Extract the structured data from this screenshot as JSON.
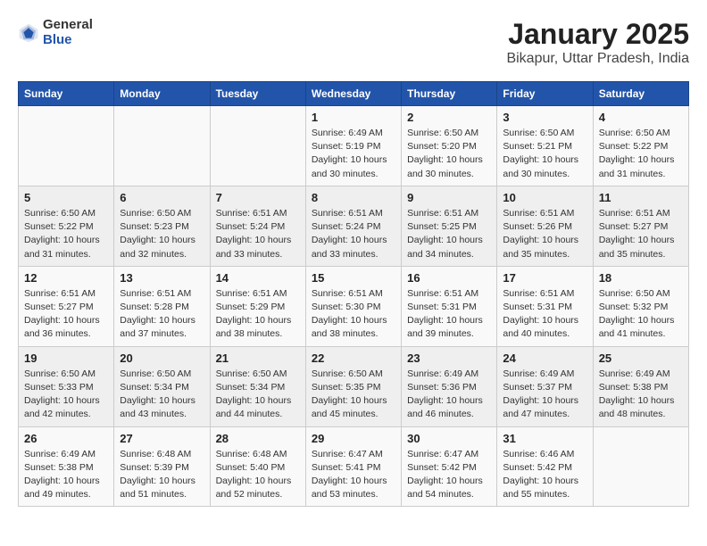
{
  "header": {
    "logo_general": "General",
    "logo_blue": "Blue",
    "title": "January 2025",
    "subtitle": "Bikapur, Uttar Pradesh, India"
  },
  "days_of_week": [
    "Sunday",
    "Monday",
    "Tuesday",
    "Wednesday",
    "Thursday",
    "Friday",
    "Saturday"
  ],
  "weeks": [
    [
      {
        "day": "",
        "info": ""
      },
      {
        "day": "",
        "info": ""
      },
      {
        "day": "",
        "info": ""
      },
      {
        "day": "1",
        "info": "Sunrise: 6:49 AM\nSunset: 5:19 PM\nDaylight: 10 hours\nand 30 minutes."
      },
      {
        "day": "2",
        "info": "Sunrise: 6:50 AM\nSunset: 5:20 PM\nDaylight: 10 hours\nand 30 minutes."
      },
      {
        "day": "3",
        "info": "Sunrise: 6:50 AM\nSunset: 5:21 PM\nDaylight: 10 hours\nand 30 minutes."
      },
      {
        "day": "4",
        "info": "Sunrise: 6:50 AM\nSunset: 5:22 PM\nDaylight: 10 hours\nand 31 minutes."
      }
    ],
    [
      {
        "day": "5",
        "info": "Sunrise: 6:50 AM\nSunset: 5:22 PM\nDaylight: 10 hours\nand 31 minutes."
      },
      {
        "day": "6",
        "info": "Sunrise: 6:50 AM\nSunset: 5:23 PM\nDaylight: 10 hours\nand 32 minutes."
      },
      {
        "day": "7",
        "info": "Sunrise: 6:51 AM\nSunset: 5:24 PM\nDaylight: 10 hours\nand 33 minutes."
      },
      {
        "day": "8",
        "info": "Sunrise: 6:51 AM\nSunset: 5:24 PM\nDaylight: 10 hours\nand 33 minutes."
      },
      {
        "day": "9",
        "info": "Sunrise: 6:51 AM\nSunset: 5:25 PM\nDaylight: 10 hours\nand 34 minutes."
      },
      {
        "day": "10",
        "info": "Sunrise: 6:51 AM\nSunset: 5:26 PM\nDaylight: 10 hours\nand 35 minutes."
      },
      {
        "day": "11",
        "info": "Sunrise: 6:51 AM\nSunset: 5:27 PM\nDaylight: 10 hours\nand 35 minutes."
      }
    ],
    [
      {
        "day": "12",
        "info": "Sunrise: 6:51 AM\nSunset: 5:27 PM\nDaylight: 10 hours\nand 36 minutes."
      },
      {
        "day": "13",
        "info": "Sunrise: 6:51 AM\nSunset: 5:28 PM\nDaylight: 10 hours\nand 37 minutes."
      },
      {
        "day": "14",
        "info": "Sunrise: 6:51 AM\nSunset: 5:29 PM\nDaylight: 10 hours\nand 38 minutes."
      },
      {
        "day": "15",
        "info": "Sunrise: 6:51 AM\nSunset: 5:30 PM\nDaylight: 10 hours\nand 38 minutes."
      },
      {
        "day": "16",
        "info": "Sunrise: 6:51 AM\nSunset: 5:31 PM\nDaylight: 10 hours\nand 39 minutes."
      },
      {
        "day": "17",
        "info": "Sunrise: 6:51 AM\nSunset: 5:31 PM\nDaylight: 10 hours\nand 40 minutes."
      },
      {
        "day": "18",
        "info": "Sunrise: 6:50 AM\nSunset: 5:32 PM\nDaylight: 10 hours\nand 41 minutes."
      }
    ],
    [
      {
        "day": "19",
        "info": "Sunrise: 6:50 AM\nSunset: 5:33 PM\nDaylight: 10 hours\nand 42 minutes."
      },
      {
        "day": "20",
        "info": "Sunrise: 6:50 AM\nSunset: 5:34 PM\nDaylight: 10 hours\nand 43 minutes."
      },
      {
        "day": "21",
        "info": "Sunrise: 6:50 AM\nSunset: 5:34 PM\nDaylight: 10 hours\nand 44 minutes."
      },
      {
        "day": "22",
        "info": "Sunrise: 6:50 AM\nSunset: 5:35 PM\nDaylight: 10 hours\nand 45 minutes."
      },
      {
        "day": "23",
        "info": "Sunrise: 6:49 AM\nSunset: 5:36 PM\nDaylight: 10 hours\nand 46 minutes."
      },
      {
        "day": "24",
        "info": "Sunrise: 6:49 AM\nSunset: 5:37 PM\nDaylight: 10 hours\nand 47 minutes."
      },
      {
        "day": "25",
        "info": "Sunrise: 6:49 AM\nSunset: 5:38 PM\nDaylight: 10 hours\nand 48 minutes."
      }
    ],
    [
      {
        "day": "26",
        "info": "Sunrise: 6:49 AM\nSunset: 5:38 PM\nDaylight: 10 hours\nand 49 minutes."
      },
      {
        "day": "27",
        "info": "Sunrise: 6:48 AM\nSunset: 5:39 PM\nDaylight: 10 hours\nand 51 minutes."
      },
      {
        "day": "28",
        "info": "Sunrise: 6:48 AM\nSunset: 5:40 PM\nDaylight: 10 hours\nand 52 minutes."
      },
      {
        "day": "29",
        "info": "Sunrise: 6:47 AM\nSunset: 5:41 PM\nDaylight: 10 hours\nand 53 minutes."
      },
      {
        "day": "30",
        "info": "Sunrise: 6:47 AM\nSunset: 5:42 PM\nDaylight: 10 hours\nand 54 minutes."
      },
      {
        "day": "31",
        "info": "Sunrise: 6:46 AM\nSunset: 5:42 PM\nDaylight: 10 hours\nand 55 minutes."
      },
      {
        "day": "",
        "info": ""
      }
    ]
  ]
}
